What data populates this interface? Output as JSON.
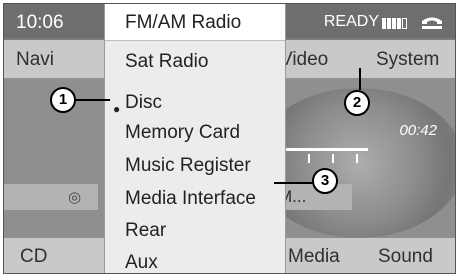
{
  "status_bar": {
    "time": "10:06",
    "ready_text": "READY",
    "signal_icon": "signal-strength-icon",
    "phone_icon": "phone-icon"
  },
  "top_nav": {
    "navi": "Navi",
    "video": "Video",
    "system": "System"
  },
  "media_menu": {
    "title": "FM/AM Radio",
    "items": [
      "Sat Radio",
      "Disc",
      "Memory Card",
      "Music Register",
      "Media Interface",
      "Rear",
      "Aux"
    ],
    "selected": "Disc"
  },
  "player": {
    "elapsed_time": "00:42",
    "cd_icon": "cd-icon",
    "track_text_partial": "M..."
  },
  "bottom_nav": {
    "cd": "CD",
    "media": "Media",
    "sound": "Sound"
  },
  "callouts": [
    "1",
    "2",
    "3"
  ]
}
